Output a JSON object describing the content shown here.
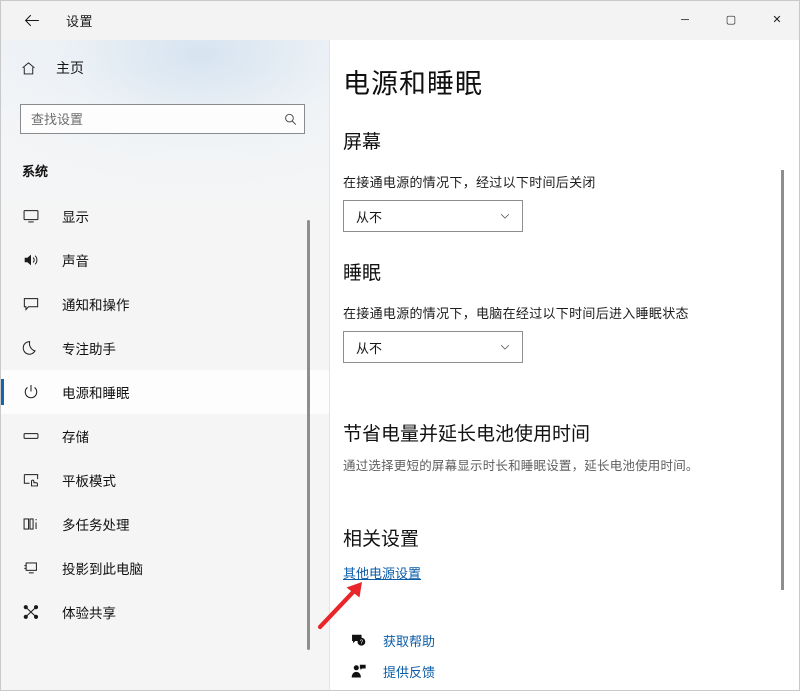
{
  "window": {
    "title": "设置",
    "back_icon": "back-arrow-icon",
    "controls": {
      "minimize": "─",
      "maximize": "▢",
      "close": "✕"
    }
  },
  "sidebar": {
    "home": {
      "label": "主页",
      "icon": "home-icon"
    },
    "search": {
      "placeholder": "查找设置",
      "value": "",
      "icon": "search-icon"
    },
    "group_title": "系统",
    "items": [
      {
        "label": "显示",
        "icon": "monitor-icon",
        "selected": false
      },
      {
        "label": "声音",
        "icon": "speaker-icon",
        "selected": false
      },
      {
        "label": "通知和操作",
        "icon": "notification-icon",
        "selected": false
      },
      {
        "label": "专注助手",
        "icon": "moon-icon",
        "selected": false
      },
      {
        "label": "电源和睡眠",
        "icon": "power-icon",
        "selected": true
      },
      {
        "label": "存储",
        "icon": "storage-icon",
        "selected": false
      },
      {
        "label": "平板模式",
        "icon": "tablet-icon",
        "selected": false
      },
      {
        "label": "多任务处理",
        "icon": "multitask-icon",
        "selected": false
      },
      {
        "label": "投影到此电脑",
        "icon": "project-icon",
        "selected": false
      },
      {
        "label": "体验共享",
        "icon": "share-icon",
        "selected": false
      }
    ]
  },
  "main": {
    "page_title": "电源和睡眠",
    "screen": {
      "heading": "屏幕",
      "label": "在接通电源的情况下，经过以下时间后关闭",
      "dropdown_value": "从不",
      "dropdown_icon": "chevron-down-icon"
    },
    "sleep": {
      "heading": "睡眠",
      "label": "在接通电源的情况下，电脑在经过以下时间后进入睡眠状态",
      "dropdown_value": "从不",
      "dropdown_icon": "chevron-down-icon"
    },
    "promo": {
      "heading": "节省电量并延长电池使用时间",
      "description": "通过选择更短的屏幕显示时长和睡眠设置，延长电池使用时间。"
    },
    "related": {
      "heading": "相关设置",
      "link": "其他电源设置"
    },
    "help_links": [
      {
        "label": "获取帮助",
        "icon": "help-bubble-icon"
      },
      {
        "label": "提供反馈",
        "icon": "feedback-person-icon"
      }
    ]
  },
  "annotation": {
    "type": "arrow",
    "color": "#e8262a",
    "points_at": "其他电源设置"
  },
  "colors": {
    "accent": "#1565a8",
    "link": "#0a5ca8",
    "annotation": "#e8262a",
    "sidebar_bg": "#f5f5f5",
    "titlebar_bg": "#f3f3f3",
    "content_bg": "#ffffff"
  }
}
